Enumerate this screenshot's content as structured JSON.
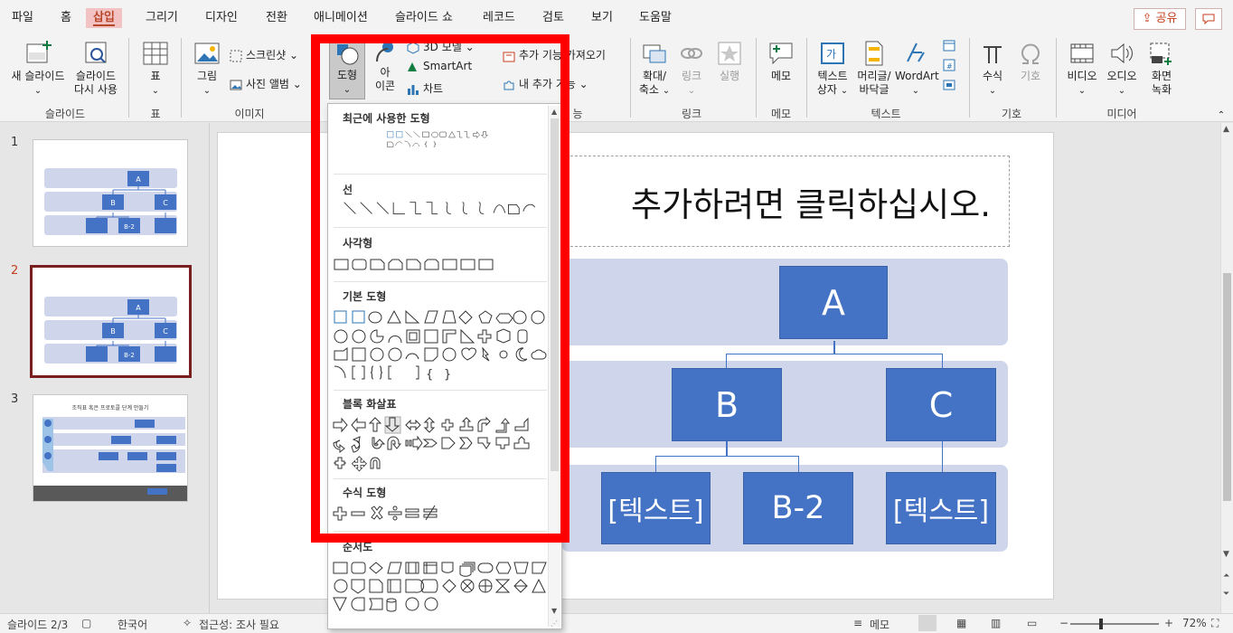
{
  "tabs": [
    "파일",
    "홈",
    "삽입",
    "그리기",
    "디자인",
    "전환",
    "애니메이션",
    "슬라이드 쇼",
    "레코드",
    "검토",
    "보기",
    "도움말"
  ],
  "header": {
    "share_label": "공유",
    "comment_icon": "comment-icon"
  },
  "ribbon": {
    "slides": {
      "new_slide": "새 슬라이드",
      "reuse_1": "슬라이드",
      "reuse_2": "다시 사용",
      "group": "슬라이드"
    },
    "table": {
      "label": "표",
      "group": "표"
    },
    "images": {
      "picture": "그림",
      "screenshot": "스크린샷",
      "album": "사진 앨범",
      "group": "이미지"
    },
    "illustrations": {
      "shapes": "도형",
      "icons_1": "아",
      "icons_2": "이콘",
      "model3d": "3D 모델",
      "smartart": "SmartArt",
      "chart": "차트"
    },
    "addins": {
      "get": "추가 기능 가져오기",
      "my": "내 추가 기능",
      "group_tail": "능"
    },
    "links": {
      "zoom_1": "확대/",
      "zoom_2": "축소",
      "link": "링크",
      "action": "실행",
      "group": "링크"
    },
    "comments": {
      "comment": "메모",
      "group": "메모"
    },
    "text": {
      "textbox_1": "텍스트",
      "textbox_2": "상자",
      "header_1": "머리글/",
      "header_2": "바닥글",
      "wordart": "WordArt",
      "group": "텍스트"
    },
    "symbols": {
      "equation": "수식",
      "symbol": "기호",
      "group": "기호"
    },
    "media": {
      "video": "비디오",
      "audio": "오디오",
      "record_1": "화면",
      "record_2": "녹화",
      "group": "미디어"
    }
  },
  "thumbnails": [
    {
      "num": "1",
      "nodes": [
        "A",
        "B",
        "C",
        "B-2"
      ]
    },
    {
      "num": "2",
      "nodes": [
        "A",
        "B",
        "C",
        "B-2"
      ]
    },
    {
      "num": "3",
      "title": "조직표 혹은 프로토콜 단계 만들기"
    }
  ],
  "slide": {
    "title_placeholder": "추가하려면 클릭하십시오.",
    "node_a": "A",
    "node_b": "B",
    "node_c": "C",
    "node_t1": "[텍스트]",
    "node_b2": "B-2",
    "node_t2": "[텍스트]"
  },
  "shapes_menu": {
    "recent": "최근에 사용한 도형",
    "lines": "선",
    "rectangles": "사각형",
    "basic": "기본 도형",
    "block_arrows": "블록 화살표",
    "equation": "수식 도형",
    "flowchart": "순서도"
  },
  "status": {
    "slide_pos": "슬라이드 2/3",
    "language": "한국어",
    "accessibility": "접근성: 조사 필요",
    "notes": "메모",
    "zoom": "72%"
  },
  "colors": {
    "accent": "#b7472a",
    "node": "#4472c4",
    "band": "#cfd5ea",
    "highlight": "#ff0000"
  }
}
